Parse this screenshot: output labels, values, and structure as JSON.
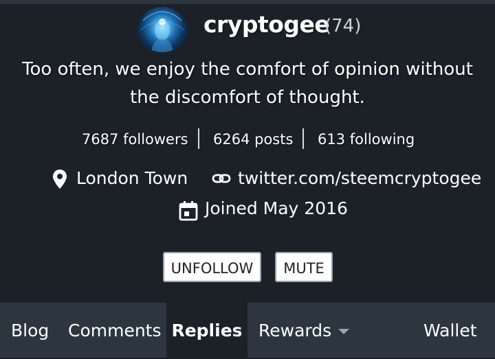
{
  "profile": {
    "username": "cryptogee",
    "reputation": "(74)",
    "about": "Too often, we enjoy the comfort of opinion without the discomfort of thought."
  },
  "stats": {
    "followers": "7687 followers",
    "posts": "6264 posts",
    "following": "613 following"
  },
  "info": {
    "location": "London Town",
    "location_icon": "map-pin-icon",
    "website": "twitter.com/steemcryptogee",
    "website_icon": "link-icon",
    "joined": "Joined May 2016",
    "joined_icon": "calendar-icon"
  },
  "actions": {
    "unfollow": "UNFOLLOW",
    "mute": "MUTE"
  },
  "tabs": [
    {
      "label": "Blog"
    },
    {
      "label": "Comments"
    },
    {
      "label": "Replies",
      "active": true
    },
    {
      "label": "Rewards",
      "icon": "dropdown-caret-icon"
    },
    {
      "label": "Wallet"
    }
  ],
  "colors": {
    "background": "#1b2127",
    "tab_bar": "#2d3640",
    "text": "#ffffff",
    "muted_text": "#cfd6dc"
  }
}
